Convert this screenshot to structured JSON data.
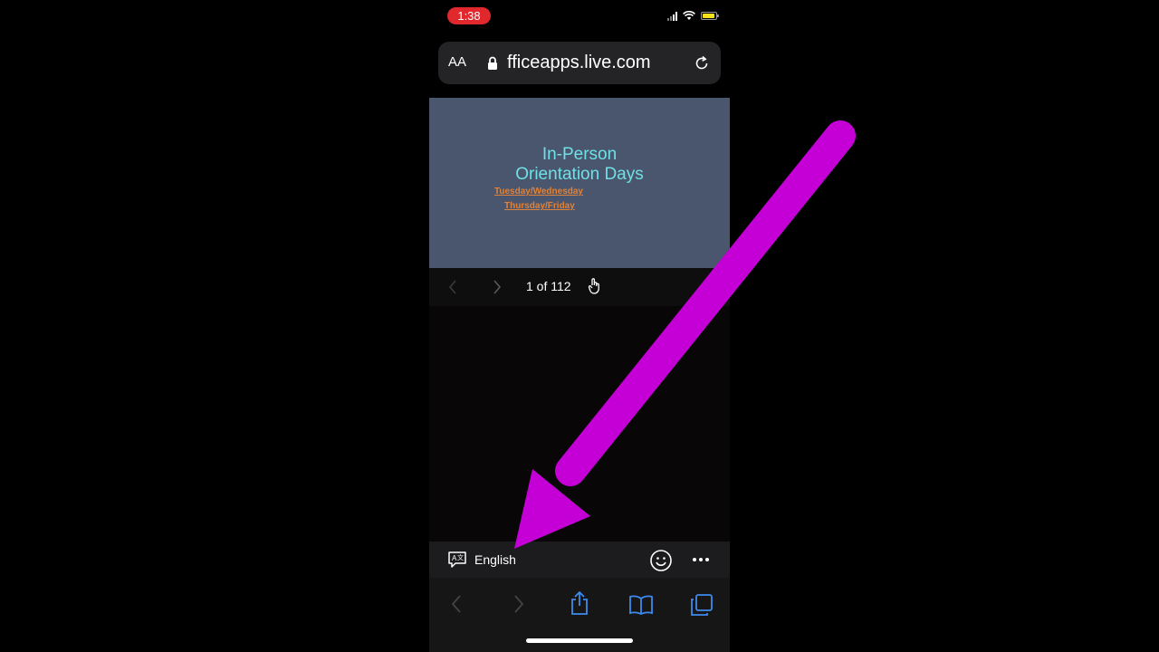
{
  "status_bar": {
    "time": "1:38"
  },
  "address_bar": {
    "text_size_label": "AA",
    "url": "fficeapps.live.com"
  },
  "slide": {
    "title_line1": "In-Person",
    "title_line2": "Orientation Days",
    "link1": "Tuesday/Wednesday",
    "link2": "Thursday/Friday"
  },
  "pager": {
    "page_count": "1 of 112"
  },
  "translate_bar": {
    "language": "English"
  },
  "colors": {
    "slide_bg": "#4a566d",
    "title": "#6ee0e6",
    "link": "#e0823a",
    "arrow": "#c400d6",
    "time_pill": "#e0282d",
    "toolbar_blue": "#3d8bf0"
  }
}
